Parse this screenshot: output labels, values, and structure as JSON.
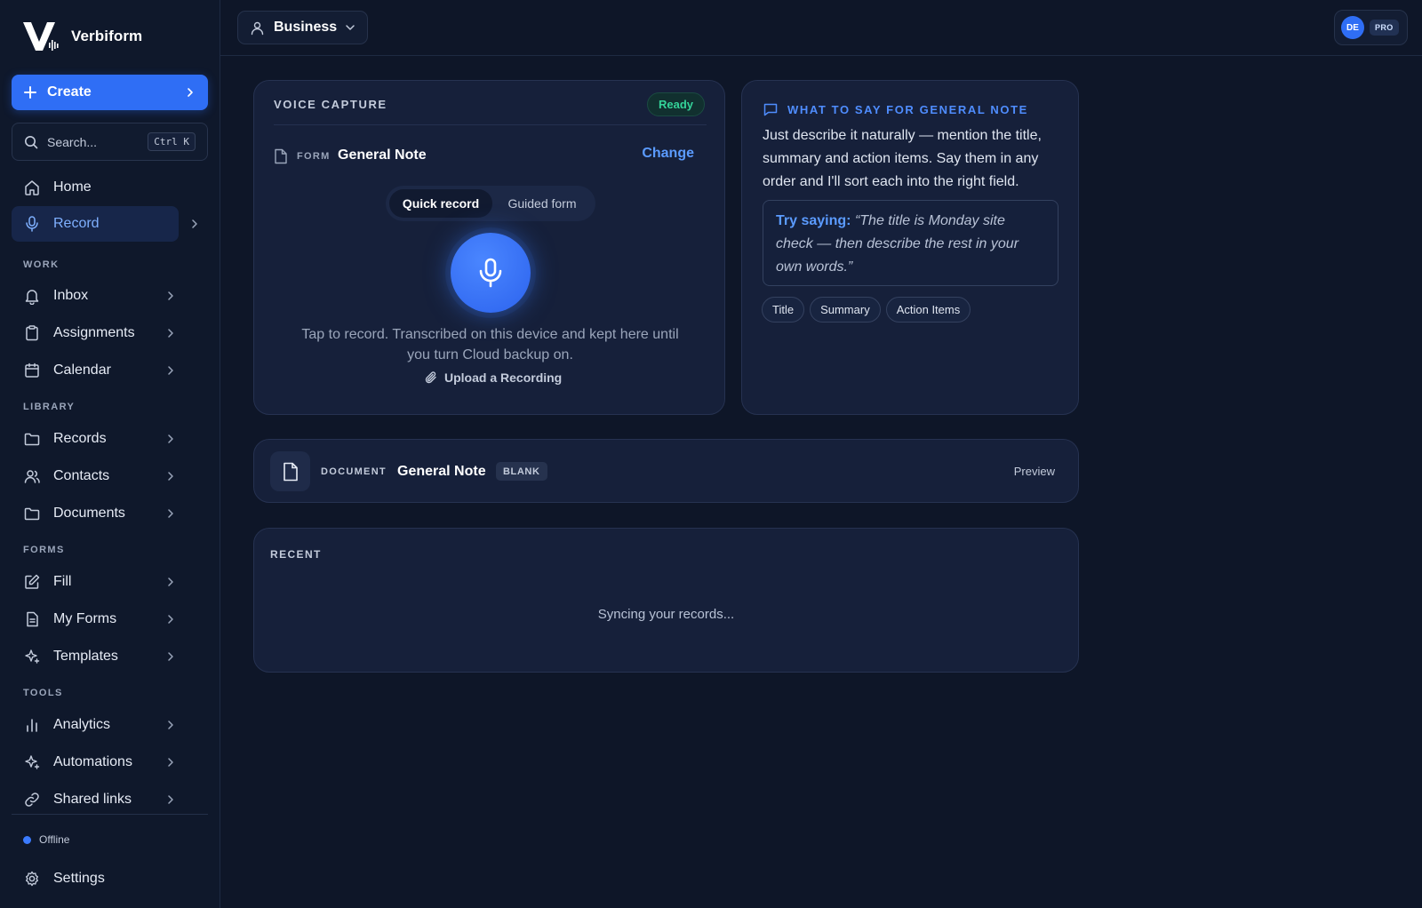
{
  "app": {
    "name": "Verbiform"
  },
  "sidebar": {
    "create_label": "Create",
    "search_placeholder": "Search...",
    "search_shortcut": "Ctrl K",
    "home": "Home",
    "record": "Record",
    "sections": {
      "work": "WORK",
      "library": "LIBRARY",
      "forms": "FORMS",
      "tools": "TOOLS"
    },
    "work_items": [
      "Inbox",
      "Assignments",
      "Calendar"
    ],
    "library_items": [
      "Records",
      "Contacts",
      "Documents"
    ],
    "forms_items": [
      "Fill",
      "My Forms",
      "Templates"
    ],
    "tools_items": [
      "Analytics",
      "Automations",
      "Shared links"
    ],
    "status": "Offline",
    "settings": "Settings"
  },
  "topbar": {
    "workspace": "Business",
    "avatar_initials": "DE",
    "plan_badge": "PRO"
  },
  "voice_capture": {
    "title": "VOICE CAPTURE",
    "status": "Ready",
    "form_key": "FORM",
    "form_value": "General Note",
    "change_label": "Change",
    "mode_options": [
      "Quick record",
      "Guided form"
    ],
    "hint": "Tap to record. Transcribed on this device and kept here until you turn Cloud backup on.",
    "upload_label": "Upload a Recording"
  },
  "guide": {
    "heading": "WHAT TO SAY FOR GENERAL NOTE",
    "description": "Just describe it naturally — mention the title, summary and action items. Say them in any order and I'll sort each into the right field.",
    "try_label": "Try saying:",
    "example": "“The title is Monday site check — then describe the rest in your own words.”",
    "fields": [
      "Title",
      "Summary",
      "Action Items"
    ]
  },
  "document": {
    "key": "DOCUMENT",
    "name": "General Note",
    "badge": "BLANK",
    "preview_label": "Preview"
  },
  "recent": {
    "title": "RECENT",
    "message": "Syncing your records..."
  },
  "colors": {
    "accent": "#2f6ef5",
    "ready": "#34d399",
    "background": "#0e1628"
  }
}
